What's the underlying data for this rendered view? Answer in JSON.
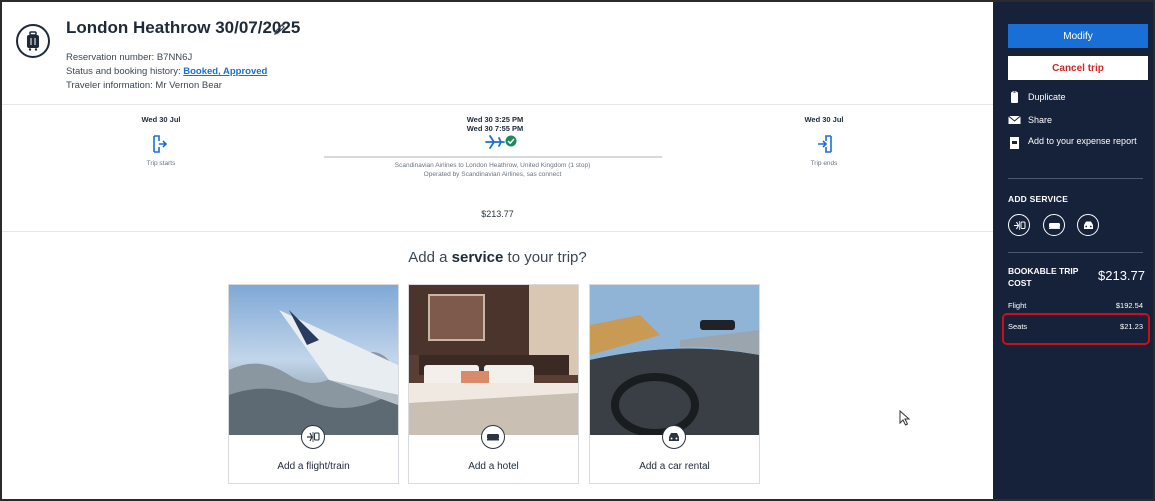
{
  "trip": {
    "title": "London Heathrow 30/07/2025",
    "reservation": "Reservation number: B7NN6J",
    "status_prefix": "Status and booking history: ",
    "status_link": "Booked, Approved",
    "traveler": "Traveler information: Mr Vernon Bear"
  },
  "timeline": {
    "start_date": "Wed 30 Jul",
    "start_label": "Trip starts",
    "depart": "Wed 30  3:25 PM",
    "arrive": "Wed 30  7:55 PM",
    "route": "Scandinavian Airlines to London Heathrow, United Kingdom (1 stop)",
    "operated": "Operated by Scandinavian Airlines, sas connect",
    "end_date": "Wed 30 Jul",
    "end_label": "Trip ends",
    "price": "$213.77"
  },
  "services": {
    "title_pre": "Add a ",
    "title_bold": "service",
    "title_post": " to your trip?",
    "cards": [
      {
        "label": "Add a flight/train",
        "icon": "flight-train-icon"
      },
      {
        "label": "Add a hotel",
        "icon": "bed-icon"
      },
      {
        "label": "Add a car rental",
        "icon": "car-icon"
      }
    ]
  },
  "sidebar": {
    "modify": "Modify",
    "cancel": "Cancel trip",
    "duplicate": "Duplicate",
    "share": "Share",
    "expense": "Add to your expense report",
    "add_service": "ADD SERVICE",
    "cost_label": "BOOKABLE TRIP COST",
    "cost_total": "$213.77",
    "flight_label": "Flight",
    "flight_value": "$192.54",
    "seats_label": "Seats",
    "seats_value": "$21.23"
  },
  "colors": {
    "sidebar_bg": "#16213a",
    "primary": "#1a6fd6",
    "danger": "#d22525",
    "highlight": "#d10b1a",
    "link": "#1a6fcf"
  }
}
